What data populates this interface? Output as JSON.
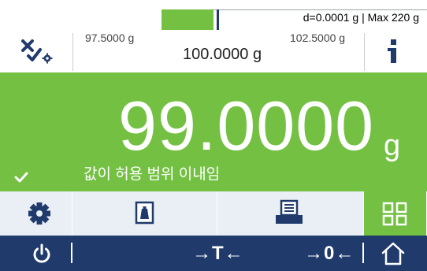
{
  "status_bar": {
    "resolution_and_capacity": "d=0.0001 g | Max 220 g",
    "tolerance_position_fraction": 0.51
  },
  "tolerance_row": {
    "lower_limit": "97.5000 g",
    "target": "100.0000 g",
    "upper_limit": "102.5000 g"
  },
  "weight_display": {
    "value": "99.0000",
    "unit": "g",
    "status_message": "값이 허용 범위 이내임"
  },
  "function_keys": [
    {
      "icon": "gear-icon"
    },
    {
      "icon": "weight-icon"
    },
    {
      "icon": "printer-icon"
    },
    {
      "icon": "grid-icon"
    }
  ],
  "navigation": {
    "tare_label": "→T←",
    "zero_label": "→0←",
    "icons": [
      "power-icon",
      "home-icon"
    ]
  },
  "colors": {
    "within_tolerance_green": "#74c043",
    "navy": "#1f3a6b",
    "function_key_bg": "#e9eff5"
  }
}
